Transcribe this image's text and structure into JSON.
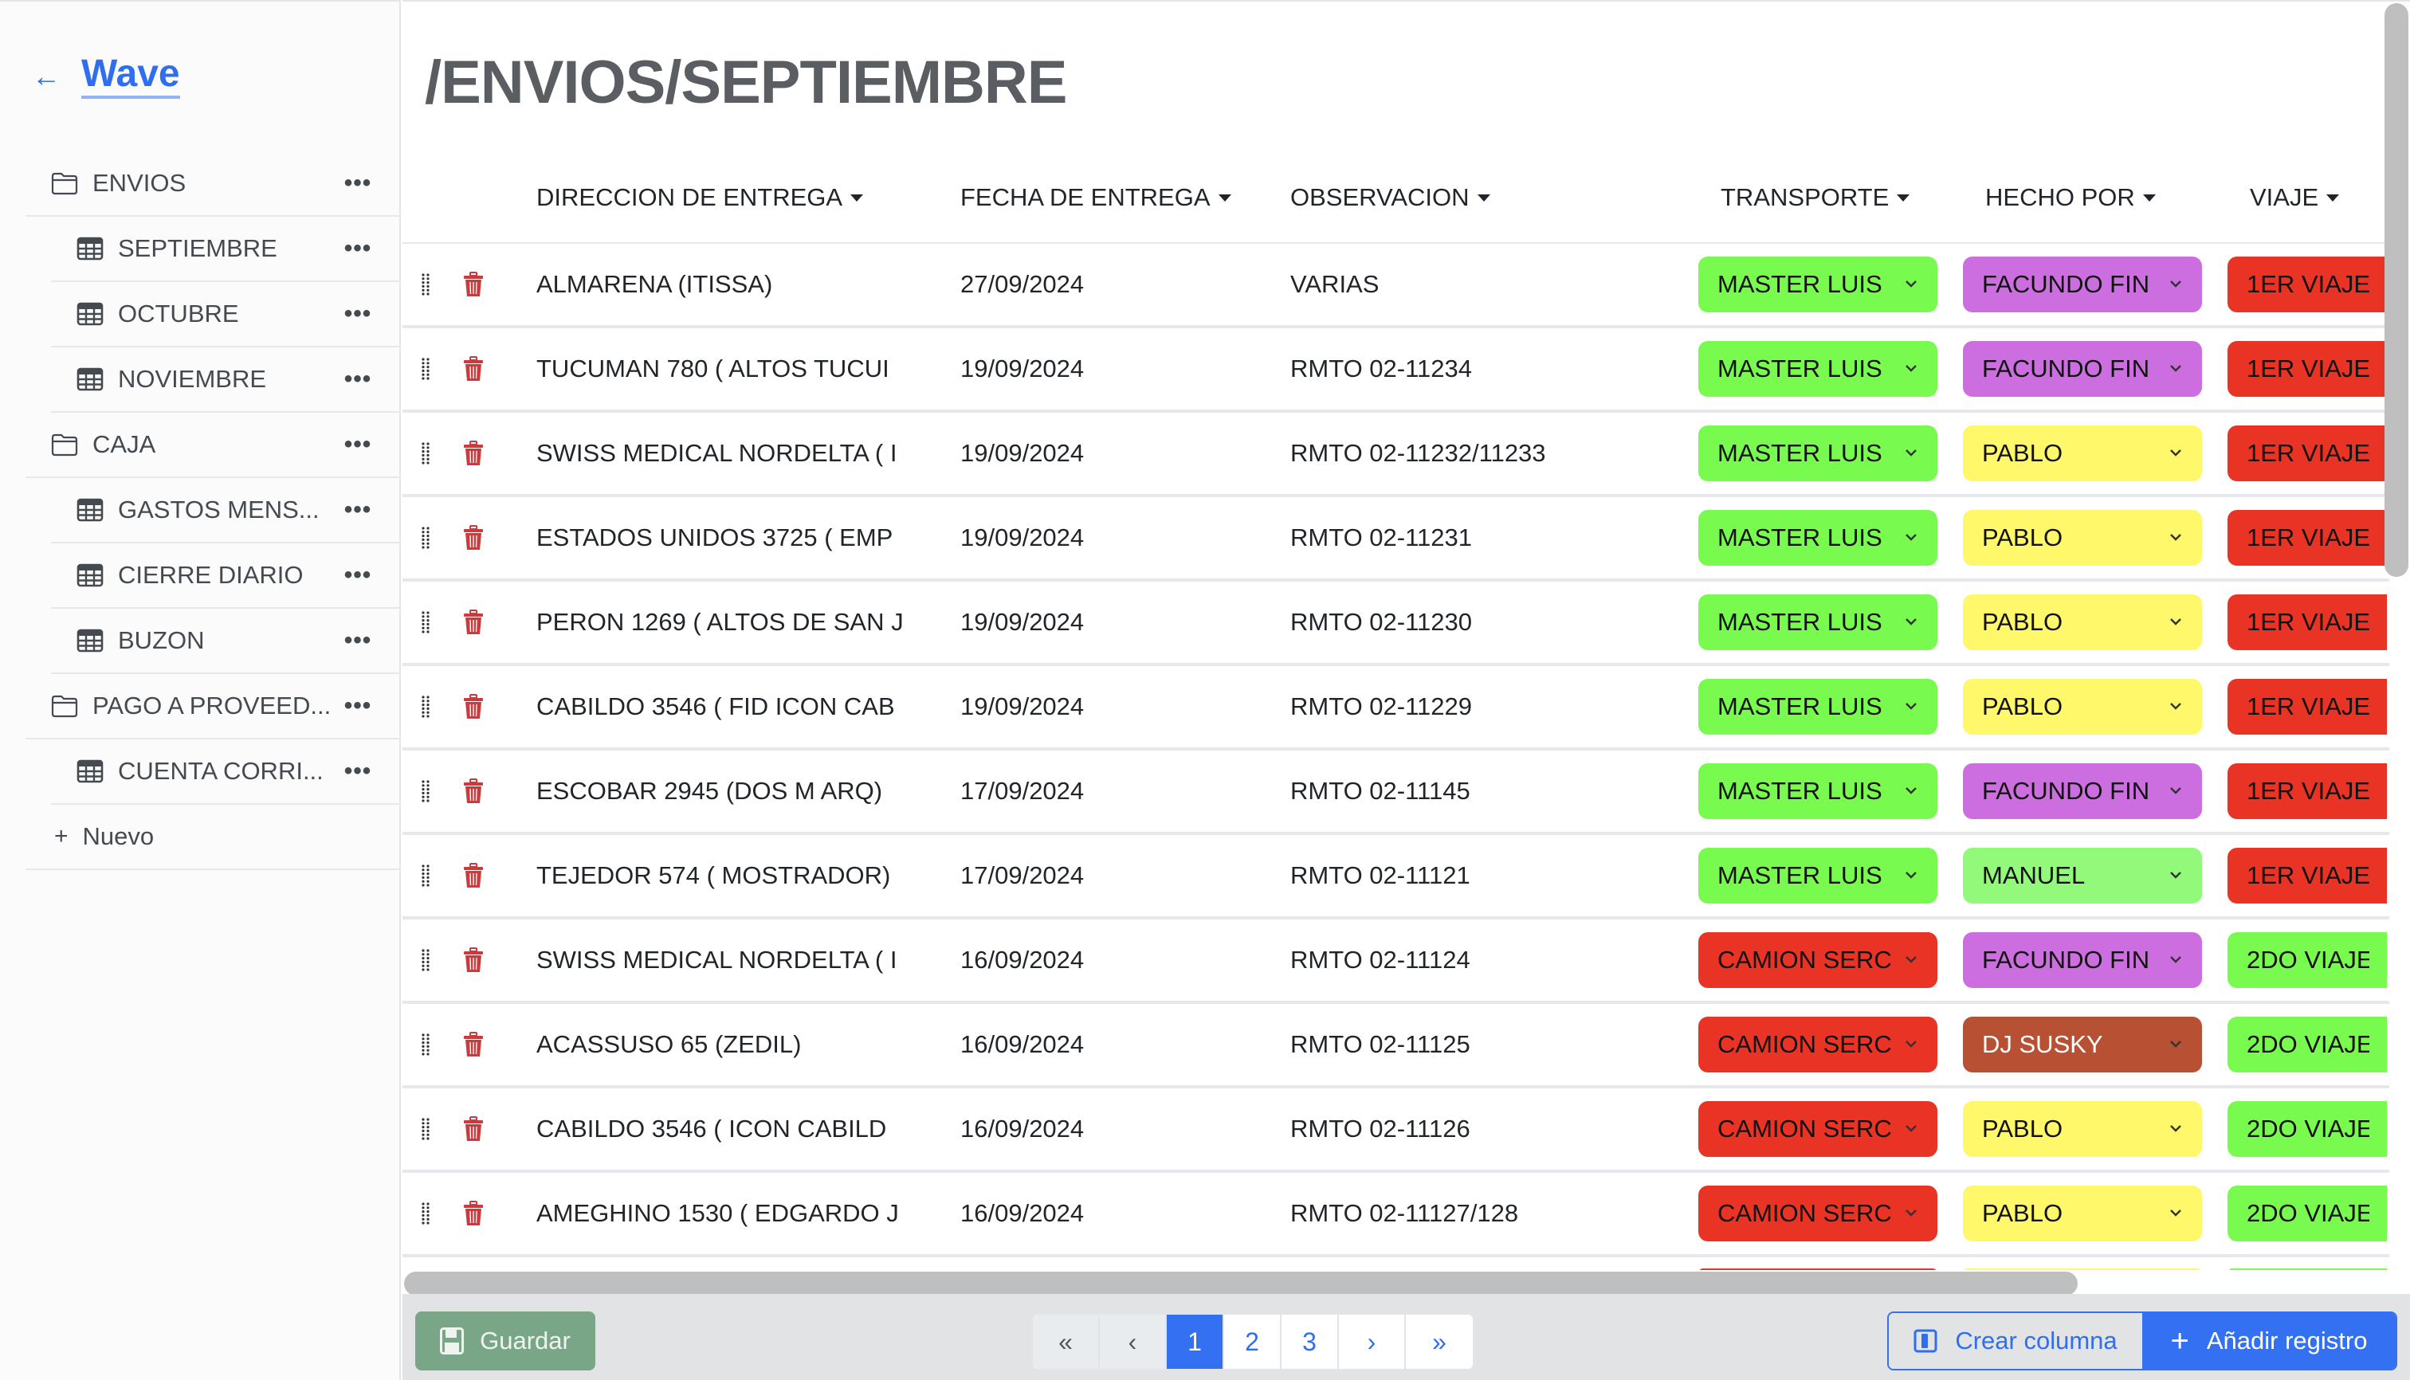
{
  "brand": {
    "back_icon": "arrow-left",
    "name": "Wave"
  },
  "sidebar": {
    "items": [
      {
        "type": "folder",
        "label": "ENVIOS",
        "icon": "folder-icon"
      },
      {
        "type": "table",
        "label": "SEPTIEMBRE",
        "icon": "table-icon"
      },
      {
        "type": "table",
        "label": "OCTUBRE",
        "icon": "table-icon"
      },
      {
        "type": "table",
        "label": "NOVIEMBRE",
        "icon": "table-icon"
      },
      {
        "type": "folder",
        "label": "CAJA",
        "icon": "folder-icon"
      },
      {
        "type": "table",
        "label": "GASTOS MENS...",
        "icon": "table-icon"
      },
      {
        "type": "table",
        "label": "CIERRE DIARIO",
        "icon": "table-icon"
      },
      {
        "type": "table",
        "label": "BUZON",
        "icon": "table-icon"
      },
      {
        "type": "folder",
        "label": "PAGO A PROVEED...",
        "icon": "folder-icon"
      },
      {
        "type": "table",
        "label": "CUENTA CORRI...",
        "icon": "table-icon"
      }
    ],
    "more_label": "•••",
    "new_label": "Nuevo",
    "new_icon": "+"
  },
  "page": {
    "title": "/ENVIOS/SEPTIEMBRE"
  },
  "table": {
    "columns": [
      "DIRECCION DE ENTREGA",
      "FECHA DE ENTREGA",
      "OBSERVACION",
      "TRANSPORTE",
      "HECHO POR",
      "VIAJE"
    ],
    "colors": {
      "MASTER LUIS": {
        "bg": "#78fa4e",
        "fg": "#111111"
      },
      "CAMION SERC": {
        "bg": "#e93325",
        "fg": "#111111"
      },
      "FACUNDO FIN": {
        "bg": "#cd6ee0",
        "fg": "#111111"
      },
      "PABLO": {
        "bg": "#fef86a",
        "fg": "#111111"
      },
      "MANUEL": {
        "bg": "#92f97a",
        "fg": "#111111"
      },
      "DJ SUSKY": {
        "bg": "#b85133",
        "fg": "#ffffff"
      },
      "1ER VIAJE": {
        "bg": "#e93325",
        "fg": "#111111"
      },
      "2DO VIAJE": {
        "bg": "#78fa4e",
        "fg": "#111111"
      }
    },
    "rows": [
      {
        "direccion": "ALMARENA (ITISSA)",
        "fecha": "27/09/2024",
        "observacion": "VARIAS",
        "transporte": "MASTER LUIS",
        "hecho_por": "FACUNDO FIN",
        "viaje": "1ER VIAJE"
      },
      {
        "direccion": "TUCUMAN 780 ( ALTOS TUCUI",
        "fecha": "19/09/2024",
        "observacion": "RMTO 02-11234",
        "transporte": "MASTER LUIS",
        "hecho_por": "FACUNDO FIN",
        "viaje": "1ER VIAJE"
      },
      {
        "direccion": "SWISS MEDICAL NORDELTA ( I",
        "fecha": "19/09/2024",
        "observacion": "RMTO 02-11232/11233",
        "transporte": "MASTER LUIS",
        "hecho_por": "PABLO",
        "viaje": "1ER VIAJE"
      },
      {
        "direccion": "ESTADOS UNIDOS 3725 ( EMP",
        "fecha": "19/09/2024",
        "observacion": "RMTO 02-11231",
        "transporte": "MASTER LUIS",
        "hecho_por": "PABLO",
        "viaje": "1ER VIAJE"
      },
      {
        "direccion": "PERON 1269 ( ALTOS DE SAN J",
        "fecha": "19/09/2024",
        "observacion": "RMTO 02-11230",
        "transporte": "MASTER LUIS",
        "hecho_por": "PABLO",
        "viaje": "1ER VIAJE"
      },
      {
        "direccion": "CABILDO 3546 ( FID ICON CAB",
        "fecha": "19/09/2024",
        "observacion": "RMTO 02-11229",
        "transporte": "MASTER LUIS",
        "hecho_por": "PABLO",
        "viaje": "1ER VIAJE"
      },
      {
        "direccion": "ESCOBAR 2945 (DOS M ARQ)",
        "fecha": "17/09/2024",
        "observacion": "RMTO 02-11145",
        "transporte": "MASTER LUIS",
        "hecho_por": "FACUNDO FIN",
        "viaje": "1ER VIAJE"
      },
      {
        "direccion": "TEJEDOR 574 ( MOSTRADOR)",
        "fecha": "17/09/2024",
        "observacion": "RMTO 02-11121",
        "transporte": "MASTER LUIS",
        "hecho_por": "MANUEL",
        "viaje": "1ER VIAJE"
      },
      {
        "direccion": "SWISS MEDICAL NORDELTA ( I",
        "fecha": "16/09/2024",
        "observacion": "RMTO 02-11124",
        "transporte": "CAMION SERC",
        "hecho_por": "FACUNDO FIN",
        "viaje": "2DO VIAJE"
      },
      {
        "direccion": "ACASSUSO 65 (ZEDIL)",
        "fecha": "16/09/2024",
        "observacion": "RMTO 02-11125",
        "transporte": "CAMION SERC",
        "hecho_por": "DJ SUSKY",
        "viaje": "2DO VIAJE"
      },
      {
        "direccion": "CABILDO 3546 ( ICON CABILD",
        "fecha": "16/09/2024",
        "observacion": "RMTO 02-11126",
        "transporte": "CAMION SERC",
        "hecho_por": "PABLO",
        "viaje": "2DO VIAJE"
      },
      {
        "direccion": "AMEGHINO 1530 ( EDGARDO J",
        "fecha": "16/09/2024",
        "observacion": "RMTO 02-11127/128",
        "transporte": "CAMION SERC",
        "hecho_por": "PABLO",
        "viaje": "2DO VIAJE"
      }
    ]
  },
  "footer": {
    "save_label": "Guardar",
    "pagination": {
      "first": "«",
      "prev": "‹",
      "pages": [
        "1",
        "2",
        "3"
      ],
      "current": "1",
      "next": "›",
      "last": "»"
    },
    "create_column_label": "Crear columna",
    "add_record_label": "Añadir registro"
  }
}
